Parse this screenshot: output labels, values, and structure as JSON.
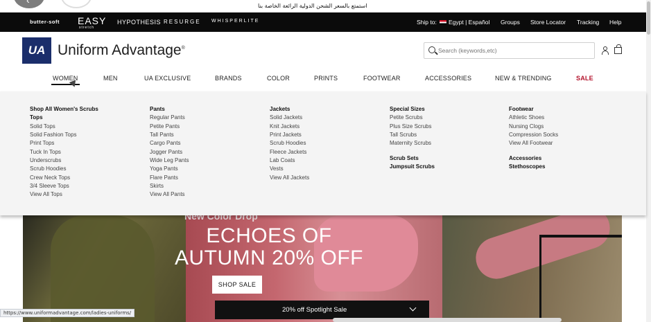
{
  "promo": {
    "text": "استمتع بالسعر الشحن الدولية الرائعة الخاصة بنا"
  },
  "brandbar": {
    "brands": [
      "butter-soft",
      "EASY",
      "HYPOTHESIS",
      "RESURGE",
      "WHISPERLITE"
    ],
    "easy_sub": "stretch",
    "ship_to_label": "Ship to:",
    "country": "Egypt | Español",
    "links": [
      "Groups",
      "Store Locator",
      "Tracking",
      "Help"
    ],
    "flag_colors": [
      "#ce1126",
      "#ffffff",
      "#000000"
    ]
  },
  "header": {
    "logo_mark": "UA",
    "logo_text": "Uniform Advantage",
    "logo_tm": "®",
    "search_placeholder": "Search (keywords,etc)",
    "brand_color": "#1b2e6b"
  },
  "nav": {
    "items": [
      "WOMEN",
      "MEN",
      "UA EXCLUSIVE",
      "BRANDS",
      "COLOR",
      "PRINTS",
      "FOOTWEAR",
      "ACCESSORIES",
      "NEW & TRENDING",
      "SALE"
    ],
    "active": "WOMEN",
    "sale_color": "#b3122b"
  },
  "menu": {
    "col1": {
      "heading": "Shop All Women's Scrubs",
      "subheading": "Tops",
      "items": [
        "Solid Tops",
        "Solid Fashion Tops",
        "Print Tops",
        "Tuck In Tops",
        "Underscrubs",
        "Scrub Hoodies",
        "Crew Neck Tops",
        "3/4 Sleeve Tops",
        "View All Tops"
      ]
    },
    "col2": {
      "heading": "Pants",
      "items": [
        "Regular Pants",
        "Petite Pants",
        "Tall Pants",
        "Cargo Pants",
        "Jogger Pants",
        "Wide Leg Pants",
        "Yoga Pants",
        "Flare Pants",
        "Skirts",
        "View All Pants"
      ]
    },
    "col3": {
      "heading": "Jackets",
      "items": [
        "Solid Jackets",
        "Knit Jackets",
        "Print Jackets",
        "Scrub Hoodies",
        "Fleece Jackets",
        "Lab Coats",
        "Vests",
        "View All Jackets"
      ]
    },
    "col4": {
      "heading": "Special Sizes",
      "items": [
        "Petite Scrubs",
        "Plus Size Scrubs",
        "Tall Scrubs",
        "Maternity Scrubs"
      ],
      "extra": [
        "Scrub Sets",
        "Jumpsuit Scrubs"
      ]
    },
    "col5": {
      "heading": "Footwear",
      "items": [
        "Athletic Shoes",
        "Nursing Clogs",
        "Compression Socks",
        "View All Footwear"
      ],
      "extra": [
        "Accessories",
        "Stethoscopes"
      ]
    }
  },
  "hero": {
    "kicker": "New Color Drop",
    "title_line1": "ECHOES OF",
    "title_line2": "AUTUMN 20% OFF",
    "button": "SHOP SALE"
  },
  "spotlight": {
    "label": "20% off Spotlight Sale"
  },
  "status": {
    "url": "https://www.uniformadvantage.com/ladies-uniforms/"
  }
}
